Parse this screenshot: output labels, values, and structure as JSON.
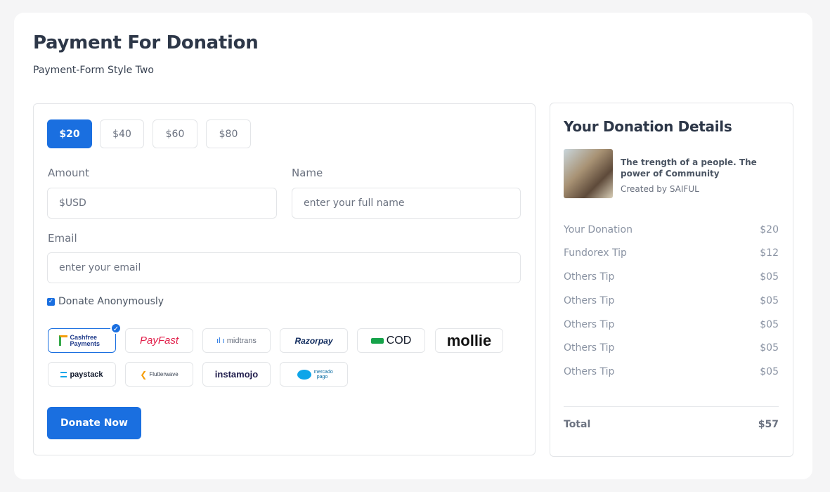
{
  "header": {
    "title": "Payment For Donation",
    "subtitle": "Payment-Form Style Two"
  },
  "amount_buttons": [
    "$20",
    "$40",
    "$60",
    "$80"
  ],
  "selected_amount": "$20",
  "form": {
    "amount_label": "Amount",
    "amount_placeholder": "$USD",
    "name_label": "Name",
    "name_placeholder": "enter your full name",
    "email_label": "Email",
    "email_placeholder": "enter your email",
    "anonymous_label": "Donate Anonymously",
    "anonymous_checked": true,
    "submit_label": "Donate Now"
  },
  "gateways": {
    "cashfree": "Cashfree Payments",
    "payfast": "PayFast",
    "midtrans": "midtrans",
    "razorpay": "Razorpay",
    "cod": "COD",
    "mollie": "mollie",
    "paystack": "paystack",
    "flutterwave": "Flutterwave",
    "instamojo": "instamojo",
    "mercadopago": "mercado pago",
    "selected": "cashfree"
  },
  "summary": {
    "title": "Your Donation Details",
    "cause_title": "The trength of a people. The power of Community",
    "cause_creator": "Created by SAIFUL",
    "rows": [
      {
        "label": "Your Donation",
        "value": "$20"
      },
      {
        "label": "Fundorex Tip",
        "value": "$12"
      },
      {
        "label": "Others Tip",
        "value": "$05"
      },
      {
        "label": "Others Tip",
        "value": "$05"
      },
      {
        "label": "Others Tip",
        "value": "$05"
      },
      {
        "label": "Others Tip",
        "value": "$05"
      },
      {
        "label": "Others Tip",
        "value": "$05"
      }
    ],
    "total_label": "Total",
    "total_value": "$57"
  },
  "colors": {
    "accent": "#1a6fe0",
    "heading": "#2d3748",
    "border": "#e3e5e8"
  }
}
